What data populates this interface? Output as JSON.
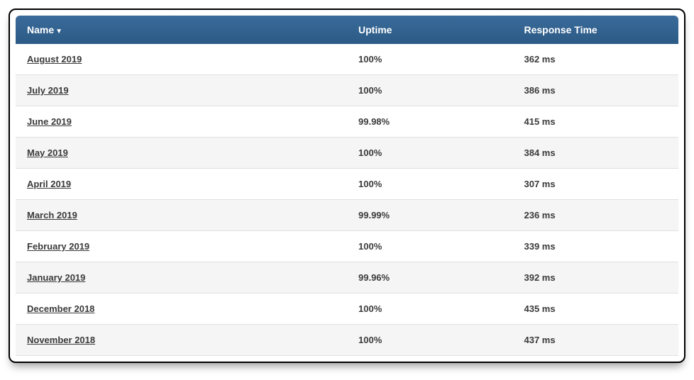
{
  "table": {
    "headers": {
      "name": "Name",
      "uptime": "Uptime",
      "response": "Response Time"
    },
    "sort_indicator": "▼",
    "rows": [
      {
        "name": "August 2019",
        "uptime": "100%",
        "response": "362 ms"
      },
      {
        "name": "July 2019",
        "uptime": "100%",
        "response": "386 ms"
      },
      {
        "name": "June 2019",
        "uptime": "99.98%",
        "response": "415 ms"
      },
      {
        "name": "May 2019",
        "uptime": "100%",
        "response": "384 ms"
      },
      {
        "name": "April 2019",
        "uptime": "100%",
        "response": "307 ms"
      },
      {
        "name": "March 2019",
        "uptime": "99.99%",
        "response": "236 ms"
      },
      {
        "name": "February 2019",
        "uptime": "100%",
        "response": "339 ms"
      },
      {
        "name": "January 2019",
        "uptime": "99.96%",
        "response": "392 ms"
      },
      {
        "name": "December 2018",
        "uptime": "100%",
        "response": "435 ms"
      },
      {
        "name": "November 2018",
        "uptime": "100%",
        "response": "437 ms"
      }
    ]
  }
}
